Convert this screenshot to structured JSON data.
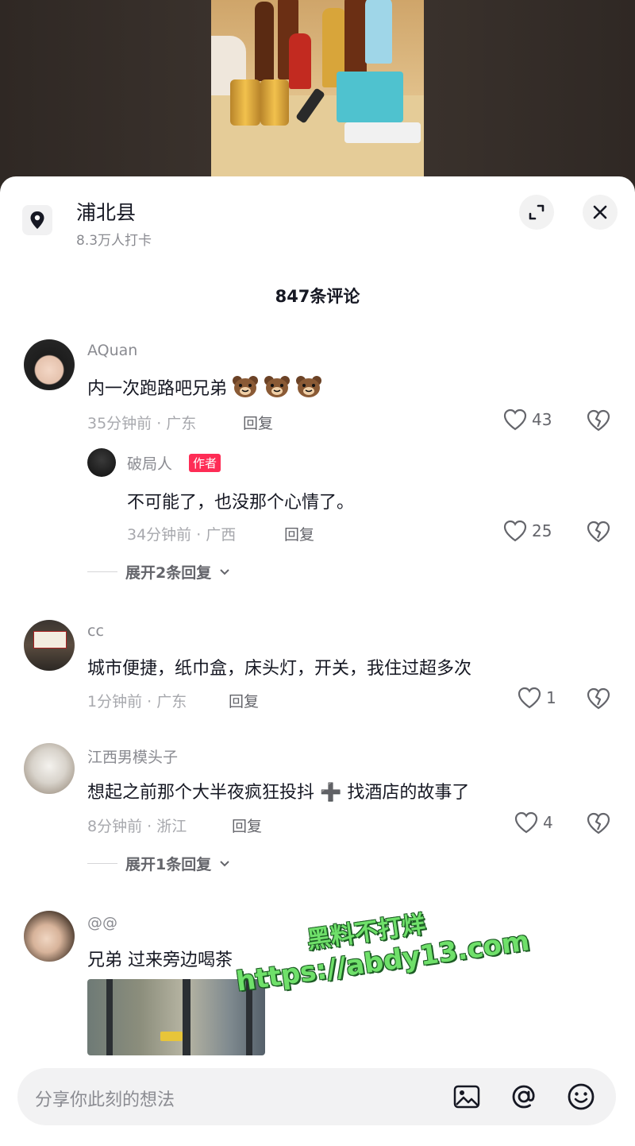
{
  "location": {
    "name": "浦北县",
    "subtitle": "8.3万人打卡"
  },
  "comments_header": {
    "count_label": "847条评论"
  },
  "comments": [
    {
      "user": "AQuan",
      "text": "内一次跑路吧兄弟",
      "meta": "35分钟前 · 广东",
      "reply_label": "回复",
      "likes": "43",
      "replies": [
        {
          "user": "破局人",
          "badge": "作者",
          "text": "不可能了，也没那个心情了。",
          "meta": "34分钟前 · 广西",
          "reply_label": "回复",
          "likes": "25"
        }
      ],
      "expand_label": "展开2条回复"
    },
    {
      "user": "cc",
      "text": "城市便捷，纸巾盒，床头灯，开关，我住过超多次",
      "meta": "1分钟前 · 广东",
      "reply_label": "回复",
      "likes": "1"
    },
    {
      "user": "江西男模头子",
      "text": "想起之前那个大半夜疯狂投抖 ➕ 找酒店的故事了",
      "meta": "8分钟前 · 浙江",
      "reply_label": "回复",
      "likes": "4",
      "expand_label": "展开1条回复"
    },
    {
      "user": "@@",
      "text": "兄弟 过来旁边喝茶"
    }
  ],
  "input": {
    "placeholder": "分享你此刻的想法"
  },
  "watermark": {
    "line1": "黑料不打烊",
    "line2": "https://abdy13.com"
  },
  "icons": {
    "location": "location-pin-icon",
    "expand": "expand-icon",
    "close": "close-icon",
    "like": "heart-icon",
    "dislike": "broken-heart-icon",
    "image": "image-icon",
    "mention": "at-icon",
    "emoji": "emoji-icon"
  },
  "colors": {
    "accent": "#fe2c55",
    "watermark": "#6fe06a"
  }
}
